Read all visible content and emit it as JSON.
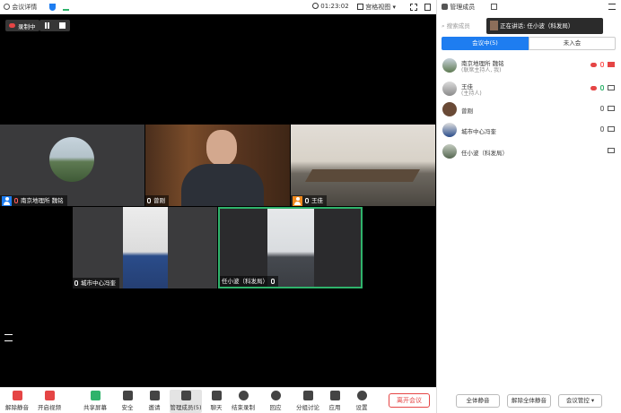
{
  "topbar": {
    "meeting_info": "会议详情",
    "timer": "01:23:02",
    "view_mode": "宫格视图"
  },
  "stage": {
    "recording_label": "录制中",
    "tiles": [
      {
        "name": "南京地理所 魏铭"
      },
      {
        "name": "曾刚"
      },
      {
        "name": "王佳"
      },
      {
        "name": "城市中心冯奎"
      },
      {
        "name": "任小波（科发局）"
      }
    ]
  },
  "toolbar": {
    "items": [
      "解除静音",
      "开启视频",
      "共享屏幕",
      "安全",
      "邀请",
      "管理成员(5)",
      "聊天",
      "结束录制",
      "回应",
      "分组讨论",
      "应用",
      "设置"
    ],
    "leave": "离开会议"
  },
  "sidebar": {
    "title": "管理成员",
    "speaking_prefix": "正在讲话:",
    "speaking_name": "任小波（科发局）",
    "search_placeholder": "搜索成员",
    "tab_in": "会议中(5)",
    "tab_out": "未入会",
    "members": [
      {
        "name": "南京地理所 魏铭",
        "sub": "(联席主持人, 我)"
      },
      {
        "name": "王佳",
        "sub": "(主持人)"
      },
      {
        "name": "曾刚",
        "sub": ""
      },
      {
        "name": "城市中心冯奎",
        "sub": ""
      },
      {
        "name": "任小波（科发局）",
        "sub": ""
      }
    ],
    "mute_all": "全体静音",
    "unmute_all": "解除全体静音",
    "control": "会议管控"
  },
  "colors": {
    "accent": "#1e7df0",
    "active_border": "#2fb36b",
    "leave": "#e54545",
    "recording": "#e54545"
  }
}
